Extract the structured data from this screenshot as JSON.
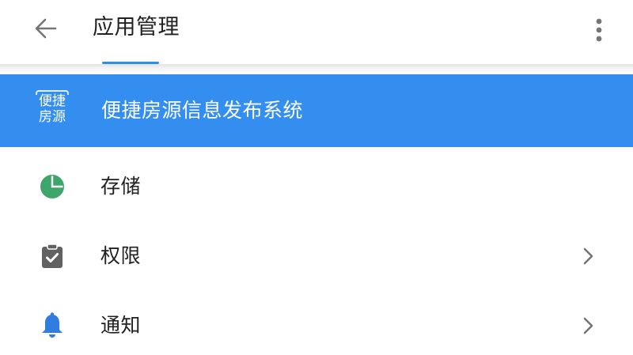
{
  "header": {
    "title": "应用管理",
    "back_icon": "arrow-back-icon",
    "more_icon": "more-vertical-icon"
  },
  "app": {
    "name": "便捷房源信息发布系统",
    "logo_text_line1": "便捷",
    "logo_text_line2": "房源",
    "banner_color": "#348ef0"
  },
  "settings": [
    {
      "id": "storage",
      "label": "存储",
      "icon": "pie-chart-icon",
      "icon_color": "#3ea66b",
      "has_chevron": false
    },
    {
      "id": "permissions",
      "label": "权限",
      "icon": "clipboard-check-icon",
      "icon_color": "#616161",
      "has_chevron": true
    },
    {
      "id": "notifications",
      "label": "通知",
      "icon": "bell-icon",
      "icon_color": "#2f7de1",
      "has_chevron": true
    }
  ],
  "colors": {
    "accent": "#2f8ee6",
    "text_primary": "#212121",
    "icon_muted": "#757575"
  }
}
